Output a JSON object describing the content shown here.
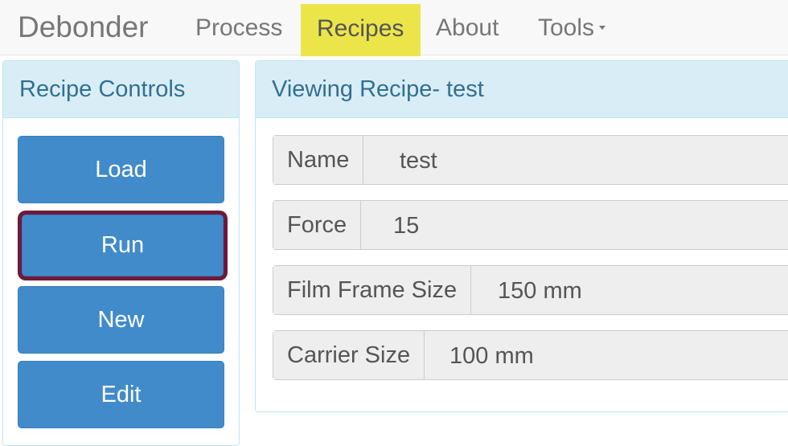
{
  "navbar": {
    "brand": "Debonder",
    "items": [
      {
        "label": "Process",
        "active": false
      },
      {
        "label": "Recipes",
        "active": true
      },
      {
        "label": "About",
        "active": false
      },
      {
        "label": "Tools",
        "active": false,
        "dropdown": true
      }
    ],
    "active_color": "#ece54a"
  },
  "controls": {
    "title": "Recipe Controls",
    "buttons": [
      "Load",
      "Run",
      "New",
      "Edit"
    ],
    "highlighted_button": "Run",
    "highlight_color": "#6e1a3b",
    "button_color": "#428bca"
  },
  "recipe": {
    "title": "Viewing Recipe- test",
    "fields": [
      {
        "label": "Name",
        "value": "test"
      },
      {
        "label": "Force",
        "value": "15"
      },
      {
        "label": "Film Frame Size",
        "value": "150 mm"
      },
      {
        "label": "Carrier Size",
        "value": "100 mm"
      }
    ]
  }
}
